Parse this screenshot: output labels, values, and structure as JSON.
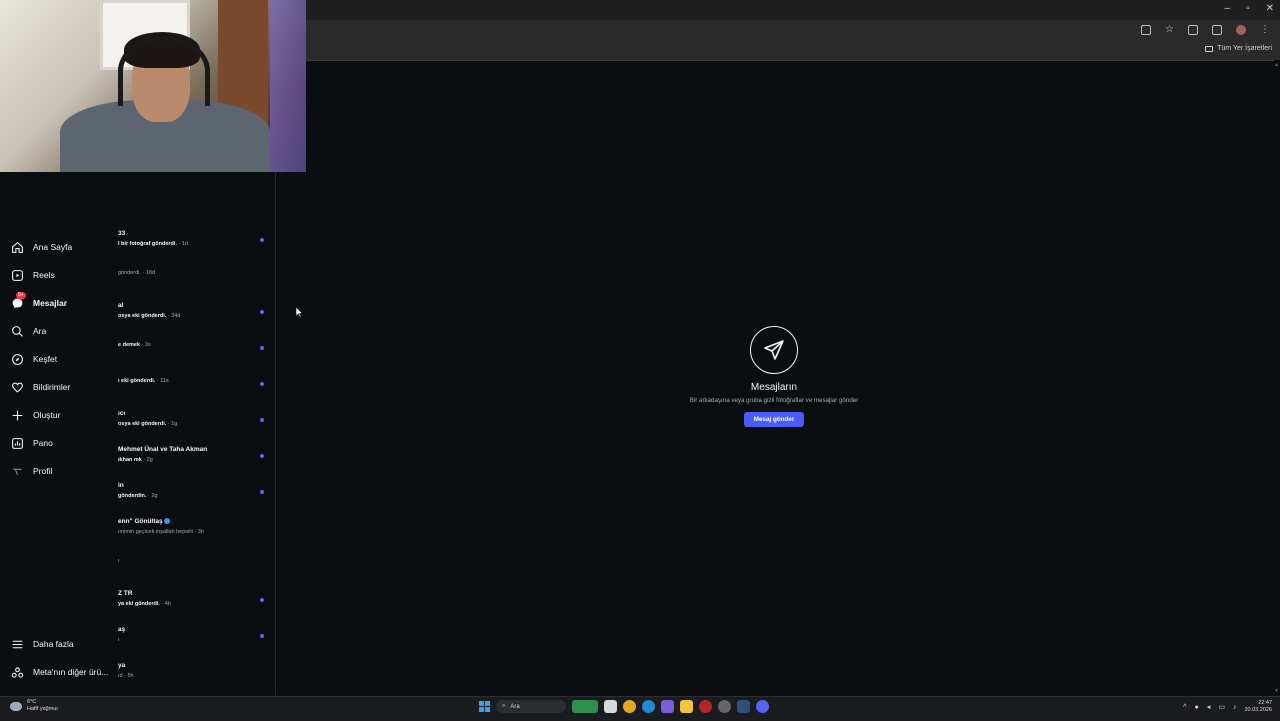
{
  "browser": {
    "window_controls": [
      "–",
      "▫",
      "✕"
    ],
    "bookmark_folder_label": "Tüm Yer İşaretleri"
  },
  "nav": {
    "items": [
      {
        "label": "Ana Sayfa",
        "icon": "home-icon"
      },
      {
        "label": "Reels",
        "icon": "reels-icon"
      },
      {
        "label": "Mesajlar",
        "icon": "messenger-icon",
        "badge": "9+",
        "active": true
      },
      {
        "label": "Ara",
        "icon": "search-icon"
      },
      {
        "label": "Keşfet",
        "icon": "compass-icon"
      },
      {
        "label": "Bildirimler",
        "icon": "heart-icon"
      },
      {
        "label": "Oluştur",
        "icon": "plus-icon"
      },
      {
        "label": "Pano",
        "icon": "dashboard-icon"
      },
      {
        "label": "Profil",
        "icon": "profile-avatar-icon"
      }
    ],
    "more_label": "Daha fazla",
    "meta_label": "Meta'nın diğer ürü..."
  },
  "conversations": [
    {
      "name": "33",
      "preview": "l bir fotoğraf gönderdi.",
      "time": "· 1d",
      "unread": true,
      "preview_bold": true
    },
    {
      "name": "",
      "preview": "gönderdi.",
      "time": "· 18d",
      "unread": false,
      "preview_bold": false
    },
    {
      "name": "al",
      "preview": "osya eki gönderdi.",
      "time": "· 34d",
      "unread": true,
      "preview_bold": true
    },
    {
      "name": "",
      "preview": "e demek",
      "time": "· 3s",
      "unread": true,
      "preview_bold": true
    },
    {
      "name": "",
      "preview": "ı eki gönderdi.",
      "time": "· 11s",
      "unread": true,
      "preview_bold": true
    },
    {
      "name": "ıcı",
      "preview": "osya eki gönderdi.",
      "time": "· 1g",
      "unread": true,
      "preview_bold": true
    },
    {
      "name": "Mehmet Ünal ve Taha Akman",
      "preview": "ıkhan mk",
      "time": "· 2g",
      "unread": true,
      "preview_bold": true
    },
    {
      "name": "in",
      "preview": "gönderdin.",
      "time": "· 2g",
      "unread": true,
      "preview_bold": true
    },
    {
      "name": "enn\" Gönültaş",
      "preview": "ımimin geçicek inşallah hepsiiii",
      "time": "· 3h",
      "unread": false,
      "preview_bold": false,
      "verified": true
    },
    {
      "name": "",
      "preview": "ı",
      "time": "",
      "unread": false,
      "preview_bold": false
    },
    {
      "name": "Z TR",
      "preview": "ya eki gönderdi.",
      "time": "· 4h",
      "unread": true,
      "preview_bold": true
    },
    {
      "name": "aş",
      "preview": "ı",
      "time": "",
      "unread": true,
      "preview_bold": false
    },
    {
      "name": "ya",
      "preview": "ıd",
      "time": "· 5h",
      "unread": false,
      "preview_bold": false
    }
  ],
  "empty_state": {
    "title": "Mesajların",
    "subtitle": "Bir arkadaşına veya gruba gizli fotoğraflar ve mesajlar gönder",
    "button": "Mesaj gönder",
    "icon": "send-icon"
  },
  "taskbar": {
    "weather_temp": "6°C",
    "weather_desc": "Hafif yağmur",
    "search_placeholder": "Ara",
    "time": "22:47",
    "date": "20.03.2026"
  },
  "colors": {
    "accent": "#4a5df9",
    "unread_dot": "#5c63f0",
    "badge": "#ff3040",
    "background": "#0b0e11"
  }
}
